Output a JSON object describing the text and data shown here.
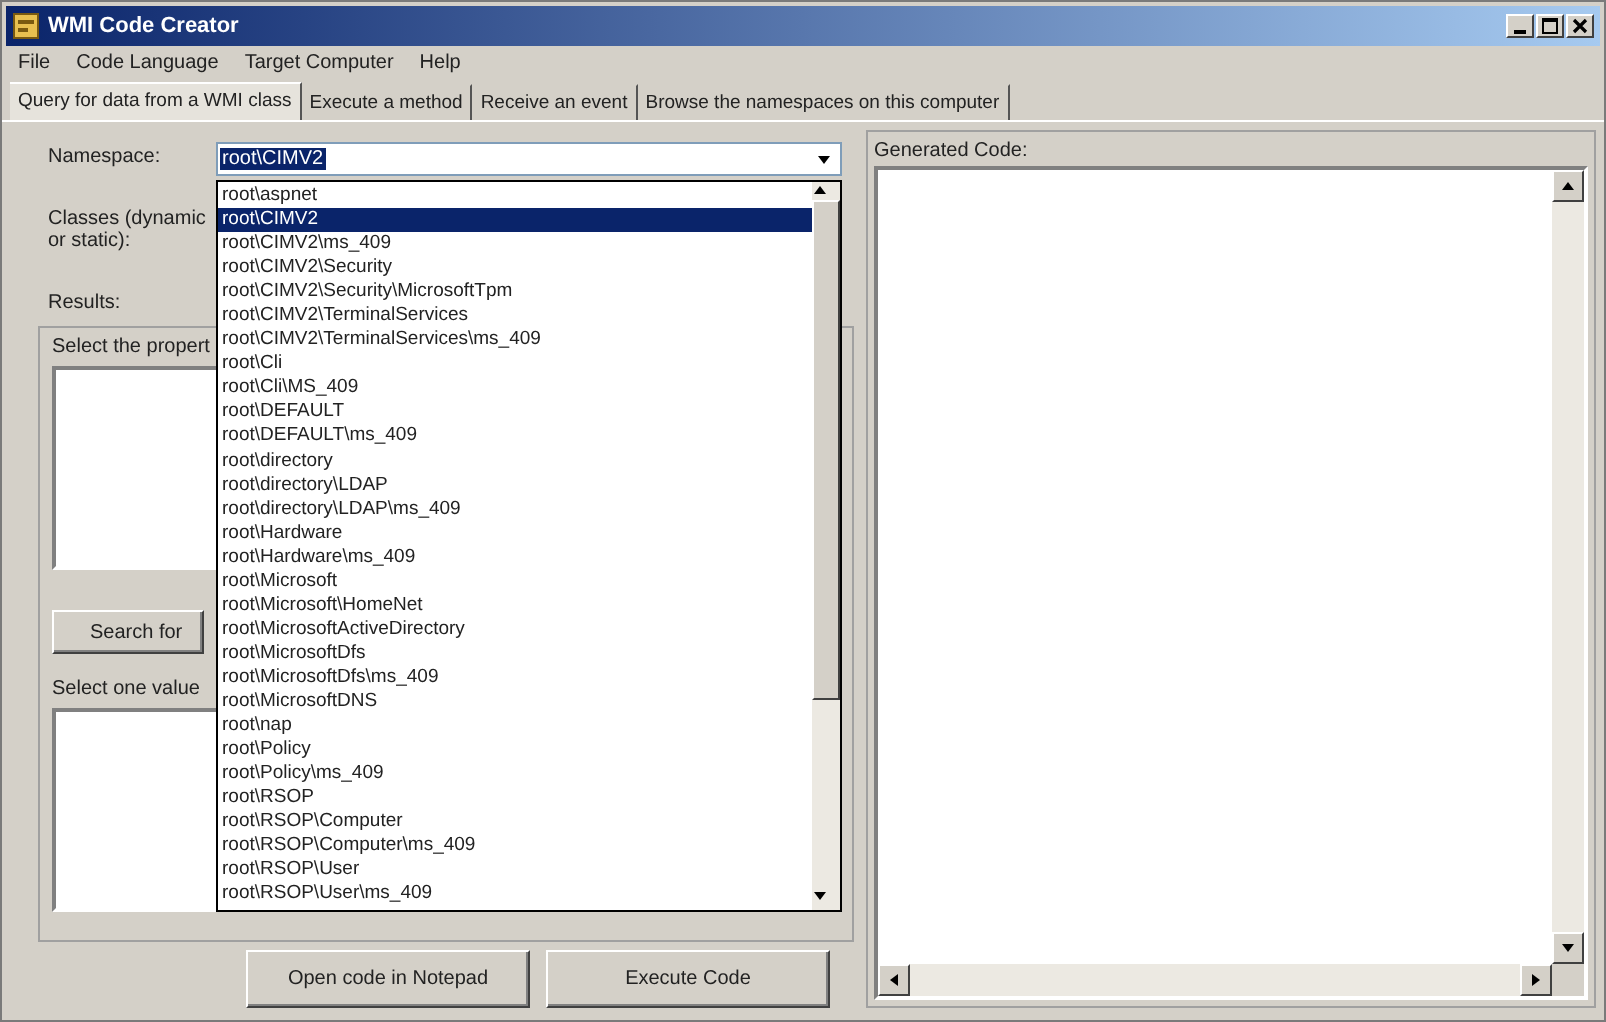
{
  "window": {
    "title": "WMI Code Creator"
  },
  "menu": [
    "File",
    "Code Language",
    "Target Computer",
    "Help"
  ],
  "tabs": [
    {
      "label": "Query for data from a WMI class",
      "selected": true
    },
    {
      "label": "Execute a method",
      "selected": false
    },
    {
      "label": "Receive an event",
      "selected": false
    },
    {
      "label": "Browse the namespaces on this computer",
      "selected": false
    }
  ],
  "query": {
    "namespace_label": "Namespace:",
    "namespace_value": "root\\CIMV2",
    "classes_label": [
      "Classes (dynamic",
      "or static):"
    ],
    "results_label": "Results:",
    "properties_label": "Select the propert",
    "search_button": "Search for",
    "values_label": "Select one value"
  },
  "namespace_dropdown": {
    "items": [
      {
        "label": "root\\aspnet",
        "selected": false
      },
      {
        "label": "root\\CIMV2",
        "selected": true
      },
      {
        "label": "root\\CIMV2\\ms_409",
        "selected": false
      },
      {
        "label": "root\\CIMV2\\Security",
        "selected": false
      },
      {
        "label": "root\\CIMV2\\Security\\MicrosoftTpm",
        "selected": false
      },
      {
        "label": "root\\CIMV2\\TerminalServices",
        "selected": false
      },
      {
        "label": "root\\CIMV2\\TerminalServices\\ms_409",
        "selected": false
      },
      {
        "label": "root\\Cli",
        "selected": false
      },
      {
        "label": "root\\Cli\\MS_409",
        "selected": false
      },
      {
        "label": "root\\DEFAULT",
        "selected": false
      },
      {
        "label": "root\\DEFAULT\\ms_409",
        "selected": false
      },
      {
        "label": "root\\directory",
        "selected": false
      },
      {
        "label": "root\\directory\\LDAP",
        "selected": false
      },
      {
        "label": "root\\directory\\LDAP\\ms_409",
        "selected": false
      },
      {
        "label": "root\\Hardware",
        "selected": false
      },
      {
        "label": "root\\Hardware\\ms_409",
        "selected": false
      },
      {
        "label": "root\\Microsoft",
        "selected": false
      },
      {
        "label": "root\\Microsoft\\HomeNet",
        "selected": false
      },
      {
        "label": "root\\MicrosoftActiveDirectory",
        "selected": false
      },
      {
        "label": "root\\MicrosoftDfs",
        "selected": false
      },
      {
        "label": "root\\MicrosoftDfs\\ms_409",
        "selected": false
      },
      {
        "label": "root\\MicrosoftDNS",
        "selected": false
      },
      {
        "label": "root\\nap",
        "selected": false
      },
      {
        "label": "root\\Policy",
        "selected": false
      },
      {
        "label": "root\\Policy\\ms_409",
        "selected": false
      },
      {
        "label": "root\\RSOP",
        "selected": false
      },
      {
        "label": "root\\RSOP\\Computer",
        "selected": false
      },
      {
        "label": "root\\RSOP\\Computer\\ms_409",
        "selected": false
      },
      {
        "label": "root\\RSOP\\User",
        "selected": false
      },
      {
        "label": "root\\RSOP\\User\\ms_409",
        "selected": false
      }
    ]
  },
  "buttons": [
    "Open code in Notepad",
    "Execute Code"
  ],
  "generated_code": {
    "label": "Generated Code:"
  }
}
